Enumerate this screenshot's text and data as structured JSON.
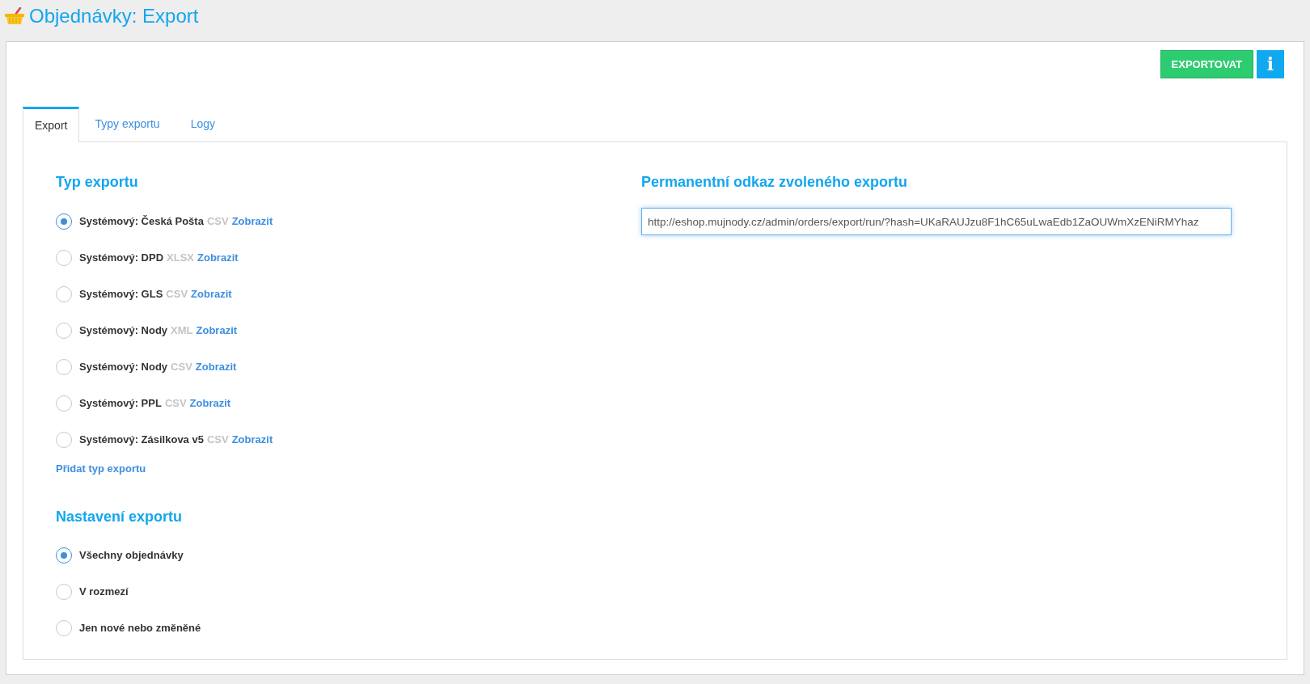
{
  "page_title": "Objednávky: Export",
  "actions": {
    "export_button": "EXPORTOVAT",
    "info_button": "i"
  },
  "tabs": [
    {
      "label": "Export",
      "selected": true
    },
    {
      "label": "Typy exportu",
      "selected": false
    },
    {
      "label": "Logy",
      "selected": false
    }
  ],
  "export_types": {
    "heading": "Typ exportu",
    "options": [
      {
        "label": "Systémový: Česká Pošta",
        "format": "CSV",
        "link": "Zobrazit",
        "selected": true
      },
      {
        "label": "Systémový: DPD",
        "format": "XLSX",
        "link": "Zobrazit",
        "selected": false
      },
      {
        "label": "Systémový: GLS",
        "format": "CSV",
        "link": "Zobrazit",
        "selected": false
      },
      {
        "label": "Systémový: Nody",
        "format": "XML",
        "link": "Zobrazit",
        "selected": false
      },
      {
        "label": "Systémový: Nody",
        "format": "CSV",
        "link": "Zobrazit",
        "selected": false
      },
      {
        "label": "Systémový: PPL",
        "format": "CSV",
        "link": "Zobrazit",
        "selected": false
      },
      {
        "label": "Systémový: Zásilkova v5",
        "format": "CSV",
        "link": "Zobrazit",
        "selected": false
      }
    ],
    "add_link": "Přidat typ exportu"
  },
  "export_settings": {
    "heading": "Nastavení exportu",
    "options": [
      {
        "label": "Všechny objednávky",
        "selected": true
      },
      {
        "label": "V rozmezí",
        "selected": false
      },
      {
        "label": "Jen nové nebo změněné",
        "selected": false
      }
    ]
  },
  "permanent_link": {
    "heading": "Permanentní odkaz zvoleného exportu",
    "value": "http://eshop.mujnody.cz/admin/orders/export/run/?hash=UKaRAUJzu8F1hC65uLwaEdb1ZaOUWmXzENiRMYhaz"
  }
}
